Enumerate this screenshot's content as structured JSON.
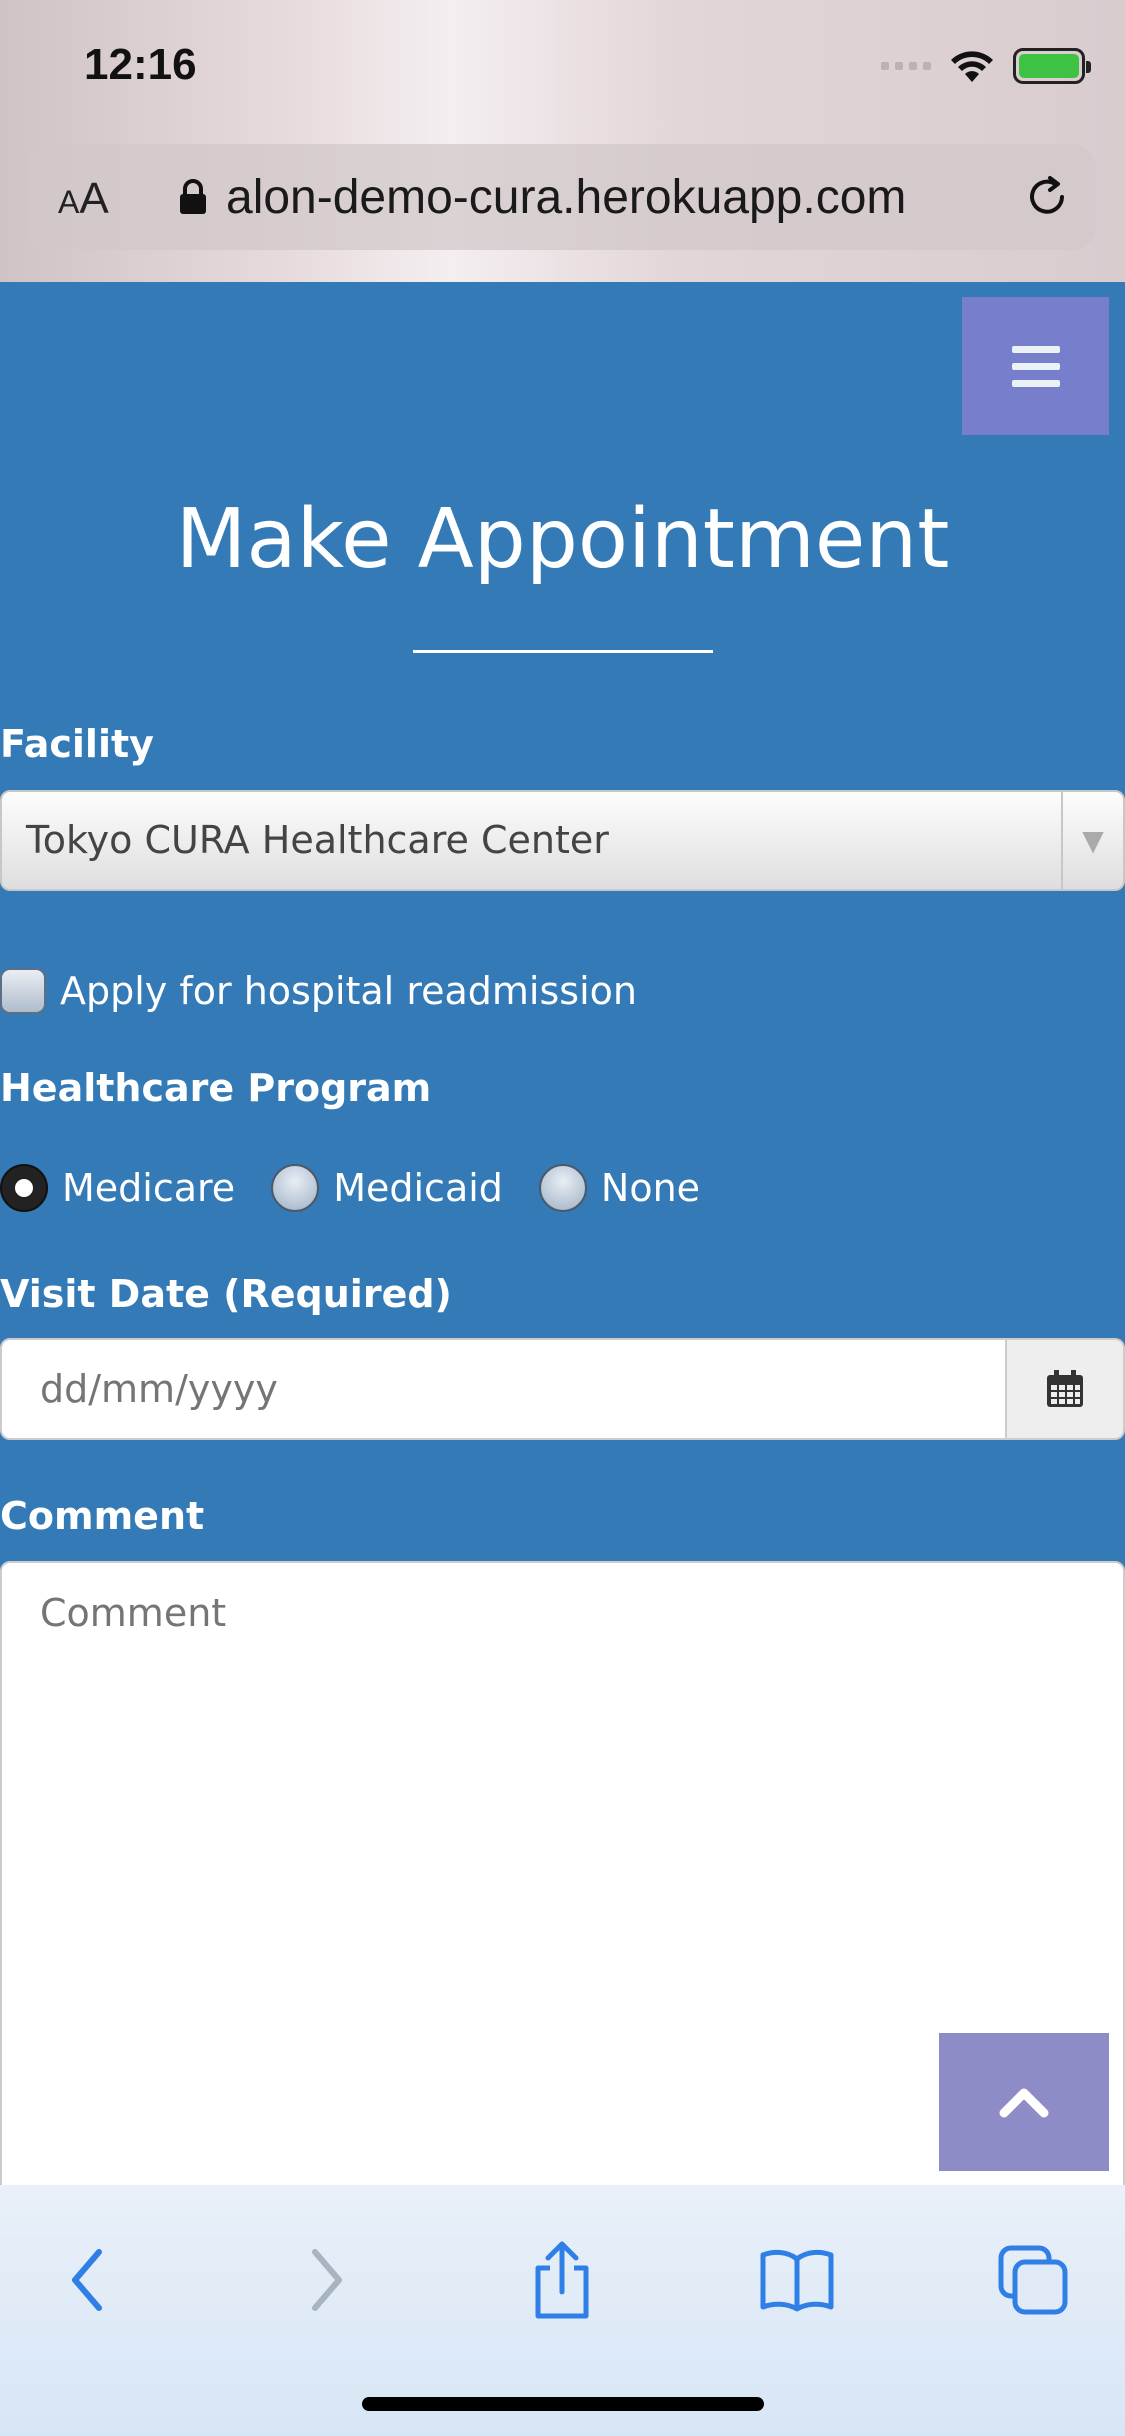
{
  "status_bar": {
    "time": "12:16"
  },
  "browser": {
    "text_size_label_small": "A",
    "text_size_label_large": "A",
    "url": "alon-demo-cura.herokuapp.com"
  },
  "page": {
    "title": "Make Appointment",
    "facility": {
      "label": "Facility",
      "selected": "Tokyo CURA Healthcare Center"
    },
    "readmission": {
      "label": "Apply for hospital readmission",
      "checked": false
    },
    "program": {
      "label": "Healthcare Program",
      "options": [
        "Medicare",
        "Medicaid",
        "None"
      ],
      "selected": "Medicare"
    },
    "visit_date": {
      "label": "Visit Date (Required)",
      "placeholder": "dd/mm/yyyy"
    },
    "comment": {
      "label": "Comment",
      "placeholder": "Comment"
    }
  },
  "icons": {
    "menu": "hamburger-icon",
    "calendar": "calendar-icon",
    "scroll_top": "chevron-up-icon",
    "toolbar": [
      "back-icon",
      "forward-icon",
      "share-icon",
      "bookmarks-icon",
      "tabs-icon"
    ]
  },
  "colors": {
    "page_background": "#337ab7",
    "menu_button": "#7f7fcf",
    "battery": "#3ec244",
    "toolbar_icon": "#2f7fe6"
  }
}
